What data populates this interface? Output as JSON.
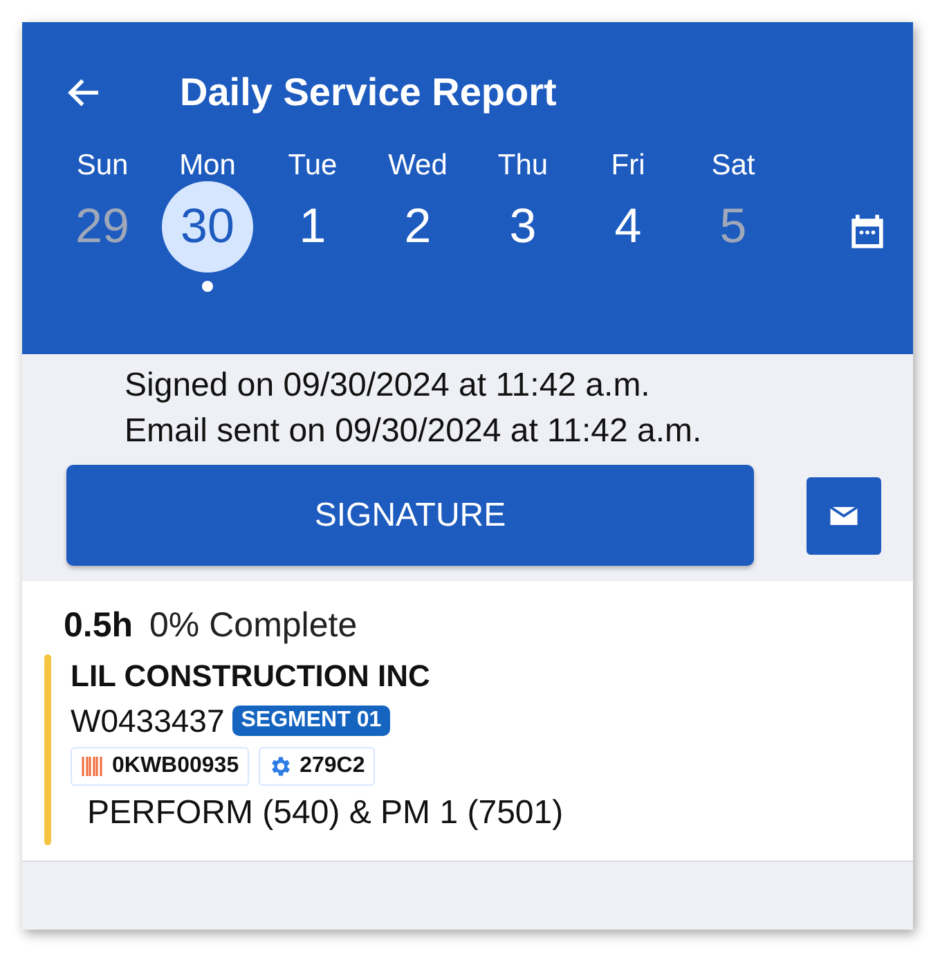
{
  "header": {
    "title": "Daily Service Report"
  },
  "days": [
    {
      "name": "Sun",
      "date": "29",
      "selected": false,
      "disabled": true,
      "has_event": false
    },
    {
      "name": "Mon",
      "date": "30",
      "selected": true,
      "disabled": false,
      "has_event": true
    },
    {
      "name": "Tue",
      "date": "1",
      "selected": false,
      "disabled": false,
      "has_event": false
    },
    {
      "name": "Wed",
      "date": "2",
      "selected": false,
      "disabled": false,
      "has_event": false
    },
    {
      "name": "Thu",
      "date": "3",
      "selected": false,
      "disabled": false,
      "has_event": false
    },
    {
      "name": "Fri",
      "date": "4",
      "selected": false,
      "disabled": false,
      "has_event": false
    },
    {
      "name": "Sat",
      "date": "5",
      "selected": false,
      "disabled": true,
      "has_event": false
    }
  ],
  "status_lines": [
    "Signed on 09/30/2024 at 11:42 a.m.",
    "Email sent on 09/30/2024 at 11:42 a.m."
  ],
  "signature_button": "SIGNATURE",
  "job": {
    "hours": "0.5h",
    "progress": "0% Complete",
    "color": "#f5c542",
    "customer": "LIL CONSTRUCTION INC",
    "work_order": "W0433437",
    "segment": "SEGMENT 01",
    "chips": [
      {
        "kind": "barcode",
        "text": "0KWB00935"
      },
      {
        "kind": "gear",
        "text": "279C2"
      }
    ],
    "description": "PERFORM (540) & PM 1 (7501)"
  }
}
